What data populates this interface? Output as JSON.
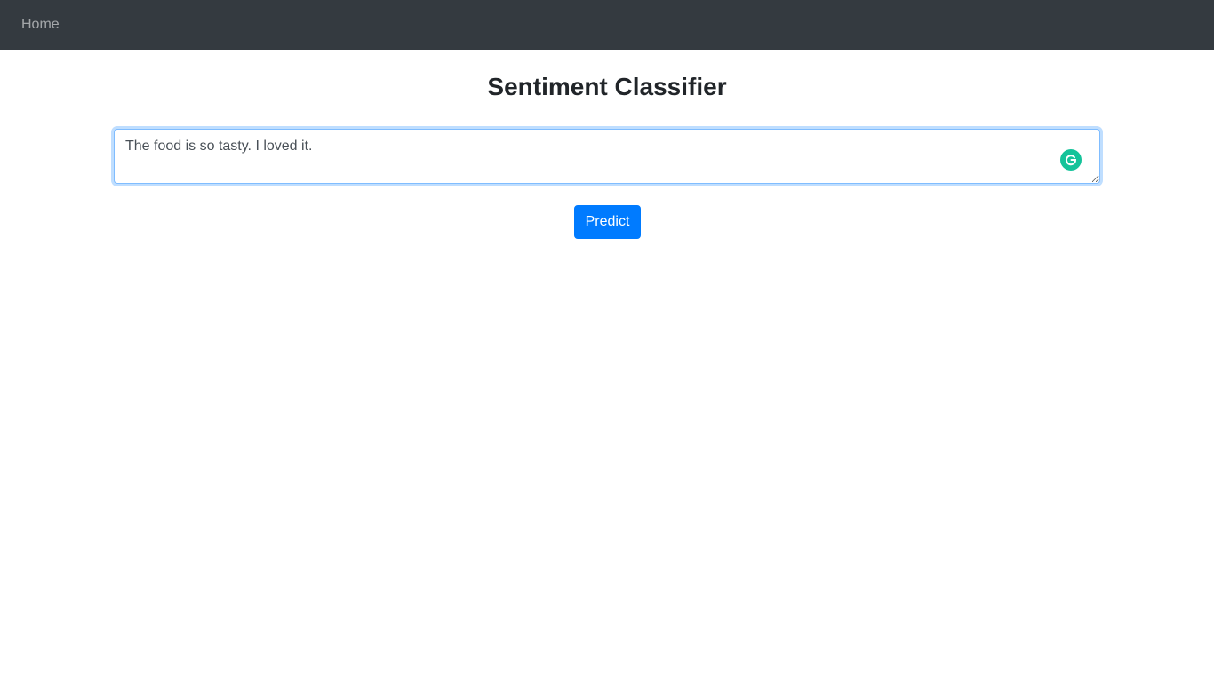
{
  "navbar": {
    "home_label": "Home",
    "background": "#343a40"
  },
  "main": {
    "title": "Sentiment Classifier",
    "text_input": {
      "value": "The food is so tasty. I loved it."
    },
    "predict_label": "Predict",
    "accent_color": "#007bff",
    "grammarly_icon": "grammarly-icon"
  }
}
